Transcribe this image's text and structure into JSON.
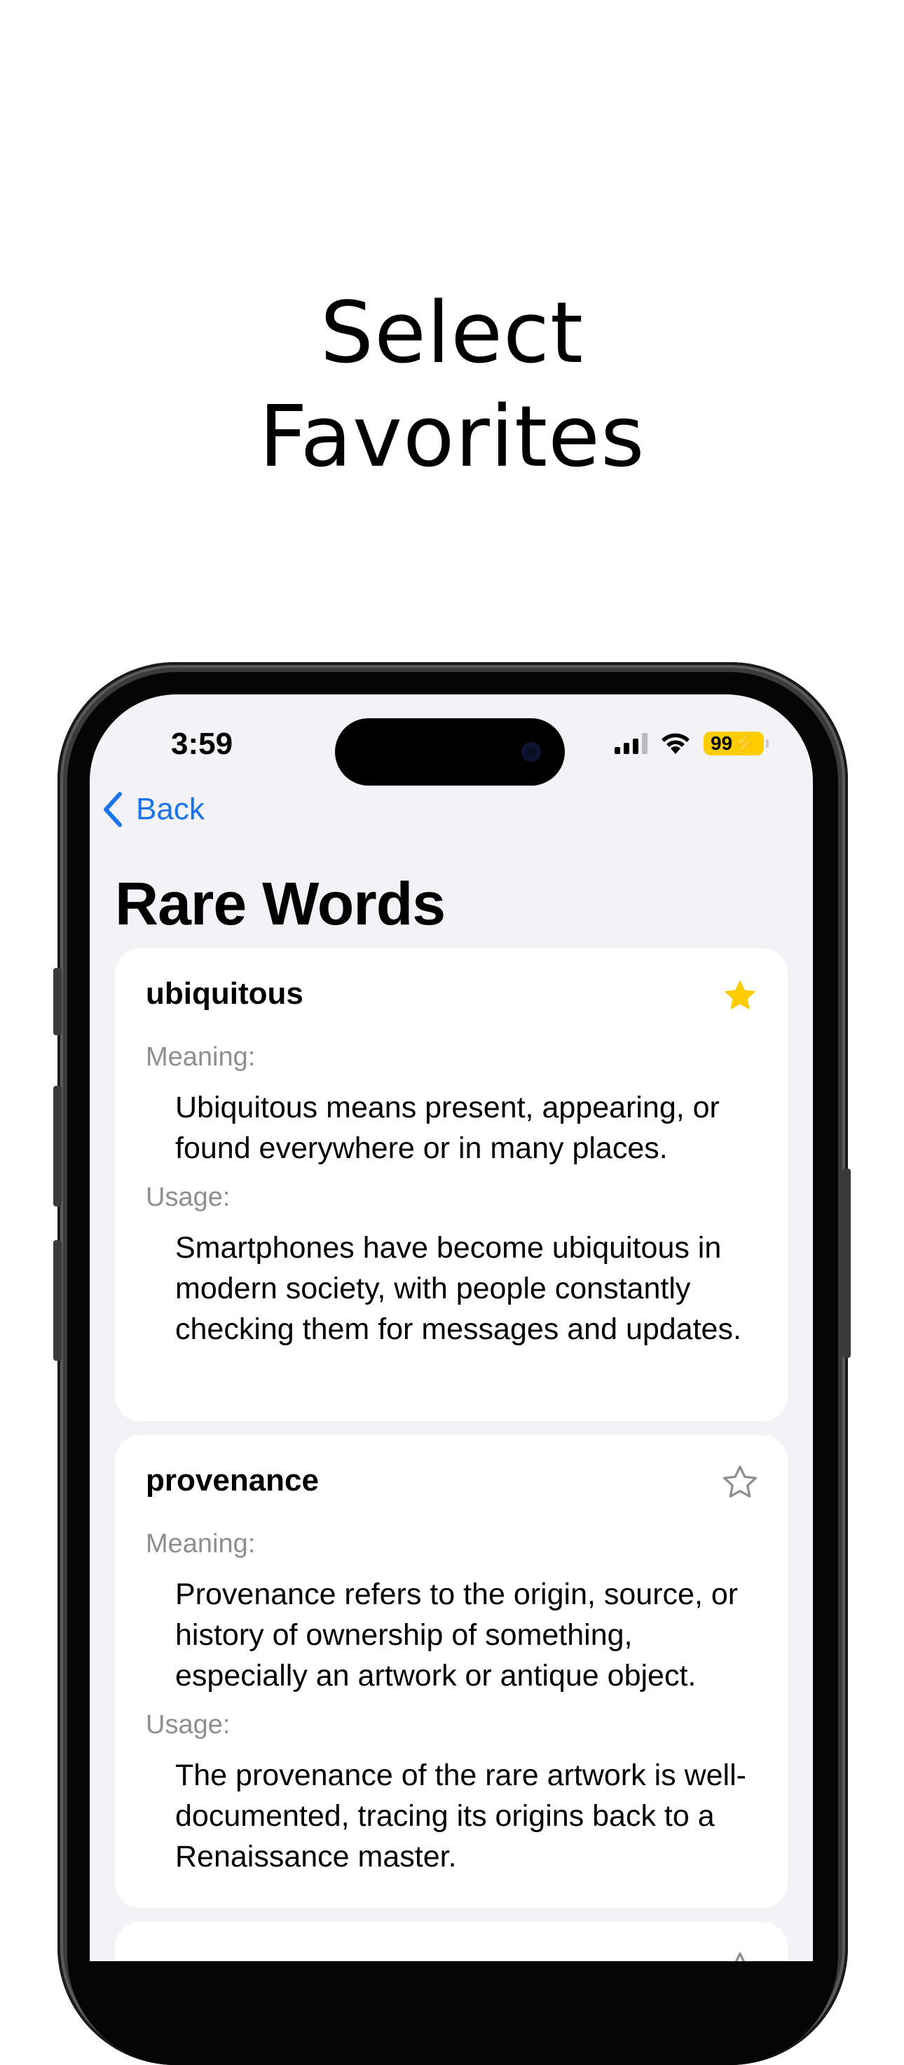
{
  "headline": {
    "line1": "Select",
    "line2": "Favorites"
  },
  "status_bar": {
    "time": "3:59",
    "battery": "99⚡"
  },
  "nav": {
    "back_label": "Back",
    "title": "Rare Words"
  },
  "words": [
    {
      "word": "ubiquitous",
      "favorite": true,
      "meaning_label": "Meaning:",
      "meaning": "Ubiquitous means present, appearing, or found everywhere or in many places.",
      "usage_label": "Usage:",
      "usage": "Smartphones have become ubiquitous in modern society, with people constantly checking them for messages and updates."
    },
    {
      "word": "provenance",
      "favorite": false,
      "meaning_label": "Meaning:",
      "meaning": "Provenance refers to the origin, source, or history of ownership of something, especially an artwork or antique object.",
      "usage_label": "Usage:",
      "usage": "The provenance of the rare artwork is well-documented, tracing its origins back to a Renaissance master."
    }
  ],
  "colors": {
    "accent_blue": "#1a73e8",
    "star_filled": "#ffcc00",
    "star_outline": "#8e8e93",
    "background": "#f2f2f7"
  }
}
